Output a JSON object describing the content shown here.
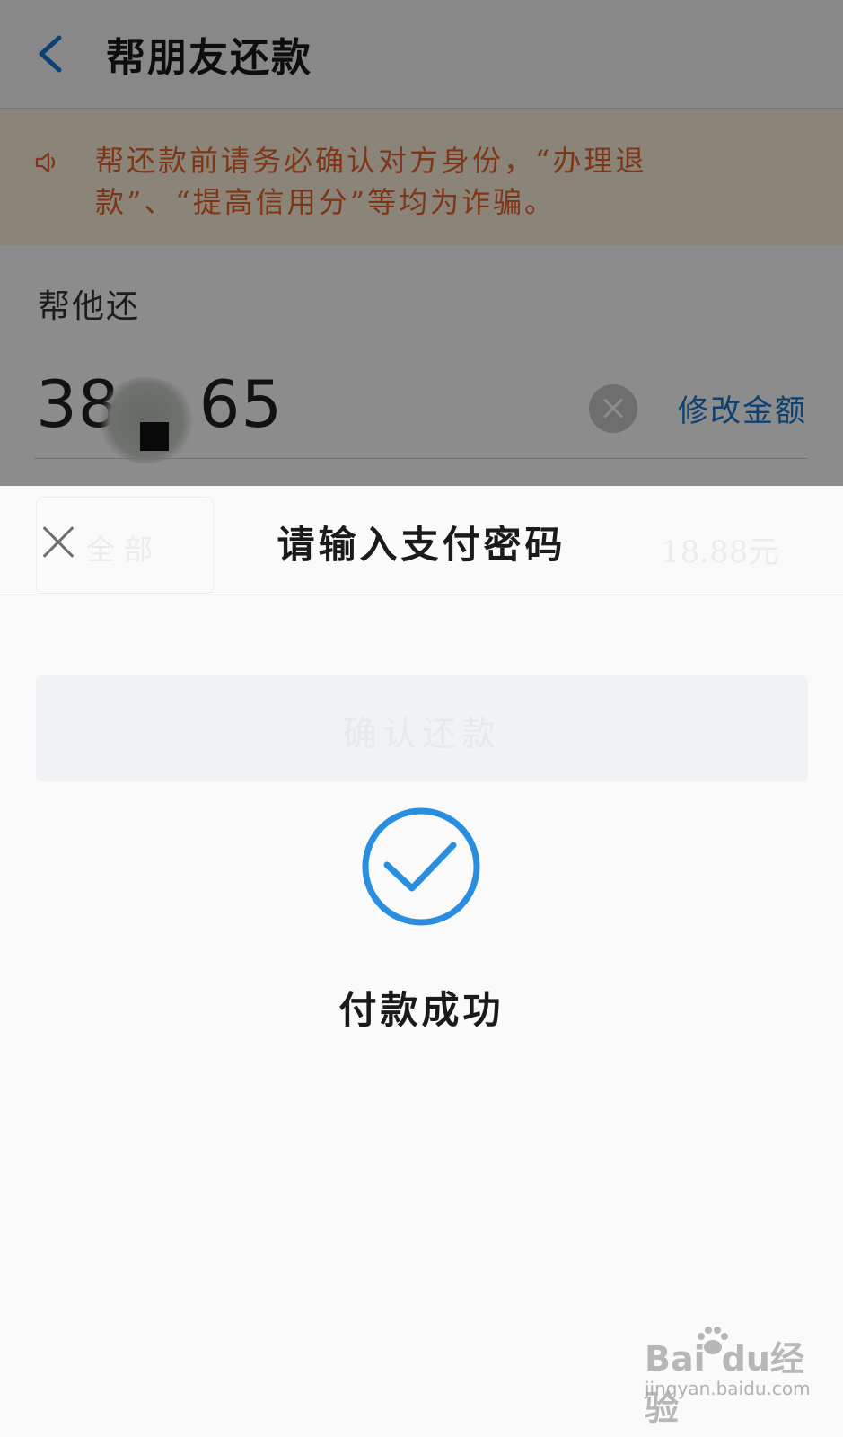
{
  "navbar": {
    "title": "帮朋友还款"
  },
  "notice": {
    "text": "帮还款前请务必确认对方身份，“办理退款”、“提高信用分”等均为诈骗。"
  },
  "repay_section": {
    "label": "帮他还",
    "amount_visible": "38  65",
    "amount_left": "38",
    "amount_right": "65",
    "edit_label": "修改金额"
  },
  "background_ghosts": {
    "chip_label": "全部",
    "limit_text": "18.88元",
    "confirm_label": "确认还款"
  },
  "payment_sheet": {
    "title": "请输入支付密码",
    "status_text": "付款成功",
    "status_icon": "check-circle-icon"
  },
  "watermark": {
    "logo": "Bai du 经验",
    "logo_left": "Bai",
    "logo_right": "du经验",
    "url": "jingyan.baidu.com"
  },
  "colors": {
    "accent_blue": "#1677d2",
    "success_blue": "#2a8ee0",
    "notice_orange": "#e8612a",
    "notice_bg": "#fef2dc"
  }
}
